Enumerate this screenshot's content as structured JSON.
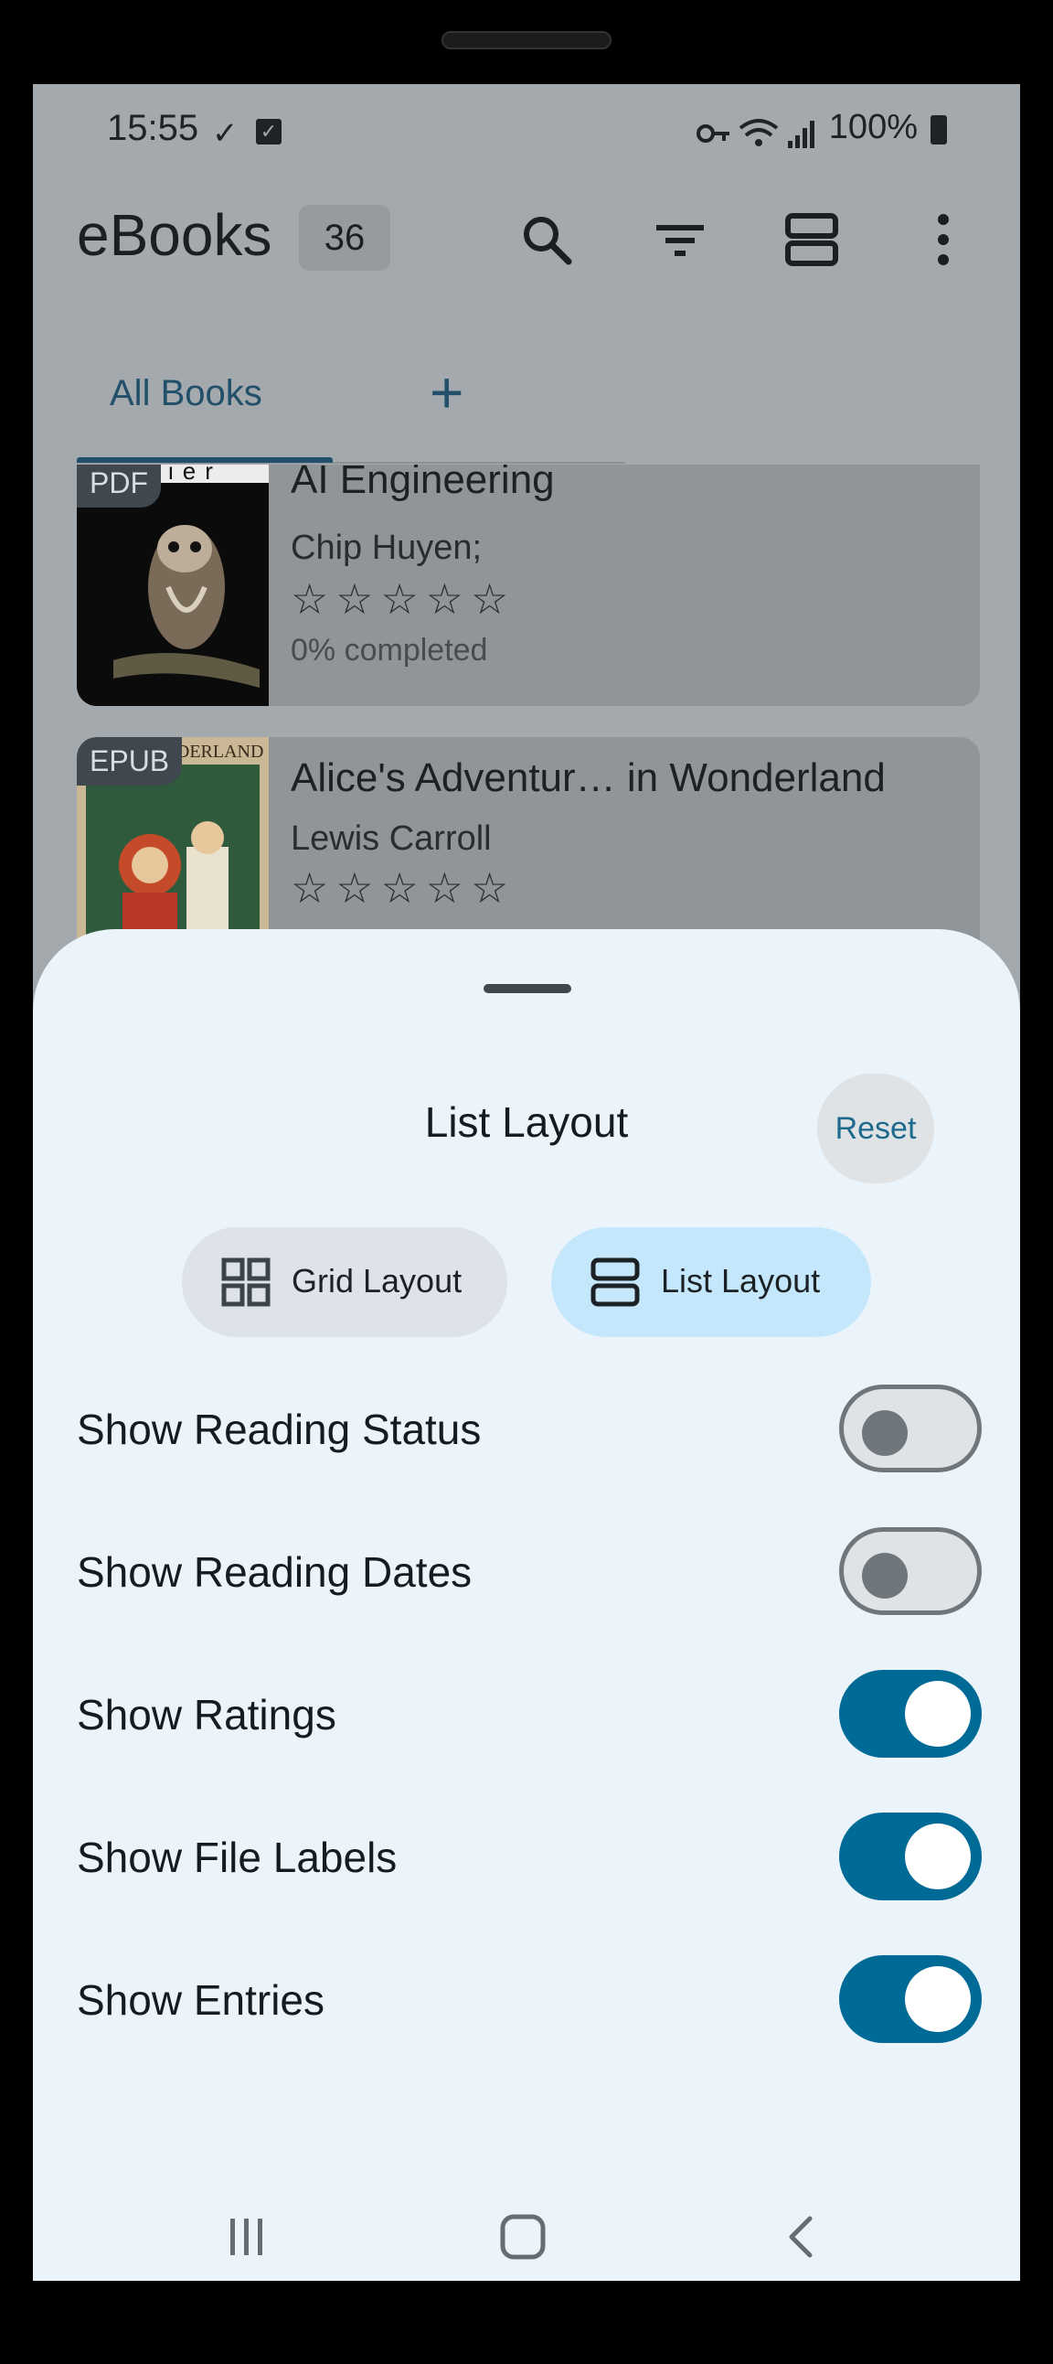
{
  "status_bar": {
    "time": "15:55",
    "battery": "100%"
  },
  "app_bar": {
    "title": "eBooks",
    "count": "36"
  },
  "tabs": {
    "all_books": "All Books",
    "add": "+"
  },
  "books": [
    {
      "cover_text": "ier",
      "badge": "PDF",
      "title": "AI Engineering",
      "author": "Chip Huyen;",
      "rating": "☆☆☆☆☆",
      "progress": "0% completed"
    },
    {
      "cover_text": "ONDERLAND",
      "badge": "EPUB",
      "title": "Alice's Adventur… in Wonderland",
      "author": "Lewis Carroll",
      "rating": "☆☆☆☆☆",
      "progress": ""
    }
  ],
  "sheet": {
    "title": "List Layout",
    "reset": "Reset",
    "grid_layout": "Grid Layout",
    "list_layout": "List Layout",
    "selected_layout": "List Layout",
    "options": [
      {
        "label": "Show Reading Status",
        "on": false
      },
      {
        "label": "Show Reading Dates",
        "on": false
      },
      {
        "label": "Show Ratings",
        "on": true
      },
      {
        "label": "Show File Labels",
        "on": true
      },
      {
        "label": "Show Entries",
        "on": true
      }
    ]
  },
  "colors": {
    "accent": "#006a96",
    "sheet_bg": "#ecf4fb",
    "selected_segment": "#c5e7fb",
    "scrim": "#a3a9ad"
  },
  "icons": [
    "search-icon",
    "filter-icon",
    "list-layout-icon",
    "more-vert-icon",
    "grid-layout-icon",
    "recents-icon",
    "home-icon",
    "back-icon"
  ]
}
